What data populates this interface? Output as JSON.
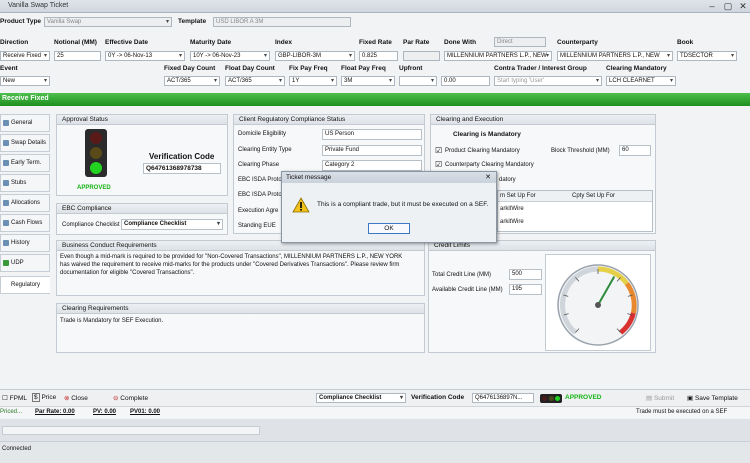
{
  "window": {
    "title": "Vanilla Swap Ticket"
  },
  "header": {
    "product_type_label": "Product Type",
    "product_type_value": "Vanilla Swap",
    "template_label": "Template",
    "template_value": "USD LIBOR A 3M"
  },
  "row1": {
    "labels": [
      "Direction",
      "Notional (MM)",
      "Effective Date",
      "Maturity Date",
      "Index",
      "Fixed Rate",
      "Par Rate",
      "Done With",
      "Counterparty",
      "Book"
    ],
    "values": [
      "Receive Fixed",
      "25",
      "0Y -> 06-Nov-13",
      "10Y -> 06-Nov-23",
      "GBP-LIBOR-3M",
      "0.825",
      "",
      "MILLENNIUM PARTNERS L.P., NEW",
      "MILLENNIUM PARTNERS L.P., NEW",
      "TDSECTOR"
    ],
    "done_with_top": "Direct"
  },
  "row2": {
    "labels": [
      "Event",
      "Fixed Day Count",
      "Float Day Count",
      "Fix Pay Freq",
      "Float Pay Freq",
      "Upfront",
      "Contra Trader / Interest Group",
      "Clearing Mandatory"
    ],
    "values": [
      "New",
      "ACT/365",
      "ACT/365",
      "1Y",
      "3M",
      "0.00",
      "Start typing 'User'",
      "LCH CLEARNET"
    ]
  },
  "section_title": "Receive Fixed",
  "sidebar": {
    "items": [
      "General",
      "Swap Details",
      "Early Term.",
      "Stubs",
      "Allocations",
      "Cash Flows",
      "History",
      "UDP",
      "Regulatory"
    ]
  },
  "approval": {
    "title": "Approval Status",
    "status": "APPROVED",
    "verification_label": "Verification Code",
    "verification_code": "Q64761368978738"
  },
  "ebc": {
    "title": "EBC Compliance",
    "checklist_label": "Compliance Checklist",
    "checklist_value": "Compliance Checklist"
  },
  "client_reg": {
    "title": "Client Regulatory Compliance Status",
    "rows": [
      {
        "label": "Domicile Eligibility",
        "value": "US Person"
      },
      {
        "label": "Clearing Entity Type",
        "value": "Private Fund"
      },
      {
        "label": "Clearing Phase",
        "value": "Category 2"
      },
      {
        "label": "EBC ISDA Proto",
        "value": ""
      },
      {
        "label": "EBC ISDA Proto",
        "value": ""
      },
      {
        "label": "Execution Agre",
        "value": ""
      },
      {
        "label": "Standing EUE",
        "value": ""
      }
    ]
  },
  "clearing": {
    "title": "Clearing and Execution",
    "mandatory": "Clearing is Mandatory",
    "product_clearing": "Product Clearing Mandatory",
    "counterparty_clearing": "Counterparty Clearing Mandatory",
    "block_threshold_label": "Block Threshold (MM)",
    "block_threshold_value": "60",
    "partial_label": "datory",
    "table_headers": [
      "m Set Up For",
      "Cpty Set Up For"
    ],
    "table_rows": [
      [
        "arkitWire",
        ""
      ],
      [
        "arkitWire",
        ""
      ]
    ]
  },
  "business": {
    "title": "Business Conduct Requirements",
    "text": "Even though a mid-mark is required to be provided for \"Non-Covered Transactions\", MILLENNIUM PARTNERS L.P., NEW YORK has waived the requirement to receive mid-marks for the products under \"Covered Derivatives Transactions\". Please review firm documentation for eligible \"Covered Transactions\"."
  },
  "clearing_req": {
    "title": "Clearing Requirements",
    "text": "Trade is Mandatory for SEF Execution."
  },
  "credit": {
    "title": "Credit Limits",
    "total_label": "Total Credit Line (MM)",
    "total_value": "500",
    "available_label": "Available Credit Line (MM)",
    "available_value": "195",
    "gauge_level": 0.61
  },
  "modal": {
    "title": "Ticket message",
    "message": "This is a compliant trade, but it must be executed on a SEF.",
    "ok": "OK"
  },
  "toolbar": {
    "fpml": "FPML",
    "price": "Price",
    "close": "Close",
    "complete": "Complete",
    "checklist_value": "Compliance Checklist",
    "verification_label": "Verification Code",
    "verification_value": "Q6476136897N...",
    "approved": "APPROVED",
    "submit": "Submit",
    "save_template": "Save Template"
  },
  "status": {
    "priced": "Priced...",
    "par_rate": "Par Rate: 0.00",
    "pv": "PV: 0.00",
    "pv01": "PV01: 0.00",
    "message": "Trade must be executed on a SEF",
    "connected": "Connected"
  },
  "colors": {
    "green": "#1e8f1e",
    "approved": "#17b317",
    "accent": "#3c78c4"
  }
}
